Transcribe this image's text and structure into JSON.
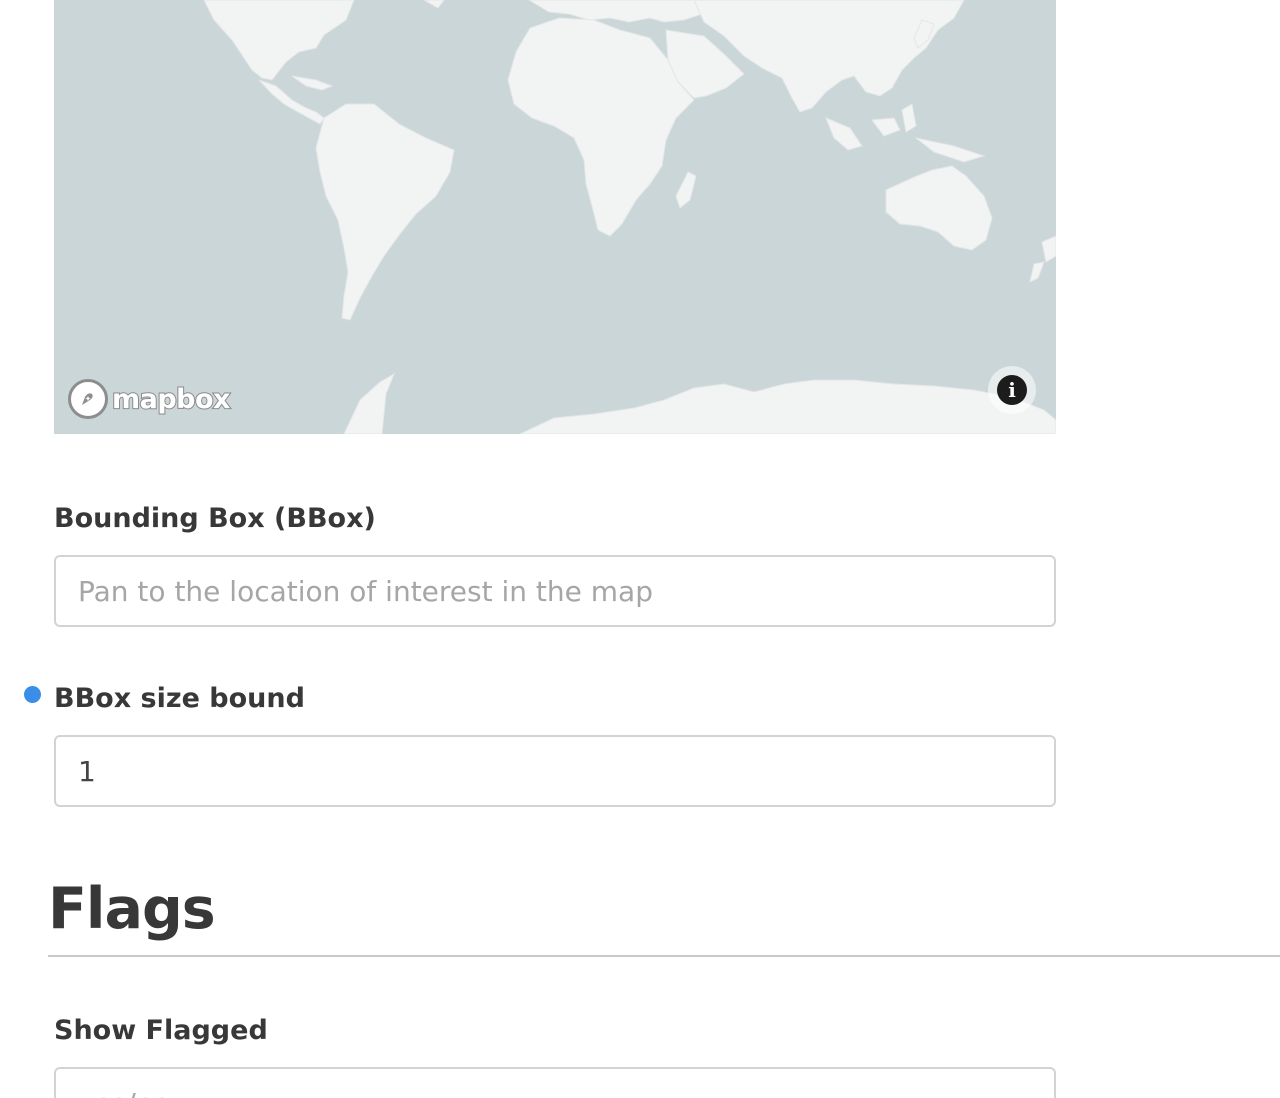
{
  "map": {
    "provider_logo": "mapbox",
    "info_icon": "info-icon",
    "info_glyph": "i",
    "ocean_color": "#cbd6d8",
    "land_color": "#f2f3f3"
  },
  "bbox": {
    "label": "Bounding Box (BBox)",
    "value": "",
    "placeholder": "Pan to the location of interest in the map"
  },
  "bbox_size": {
    "label": "BBox size bound",
    "value": "1",
    "modified_indicator_color": "#3b8ee8"
  },
  "flags": {
    "title": "Flags",
    "show_flagged": {
      "label": "Show Flagged",
      "placeholder": "yes/no"
    }
  }
}
